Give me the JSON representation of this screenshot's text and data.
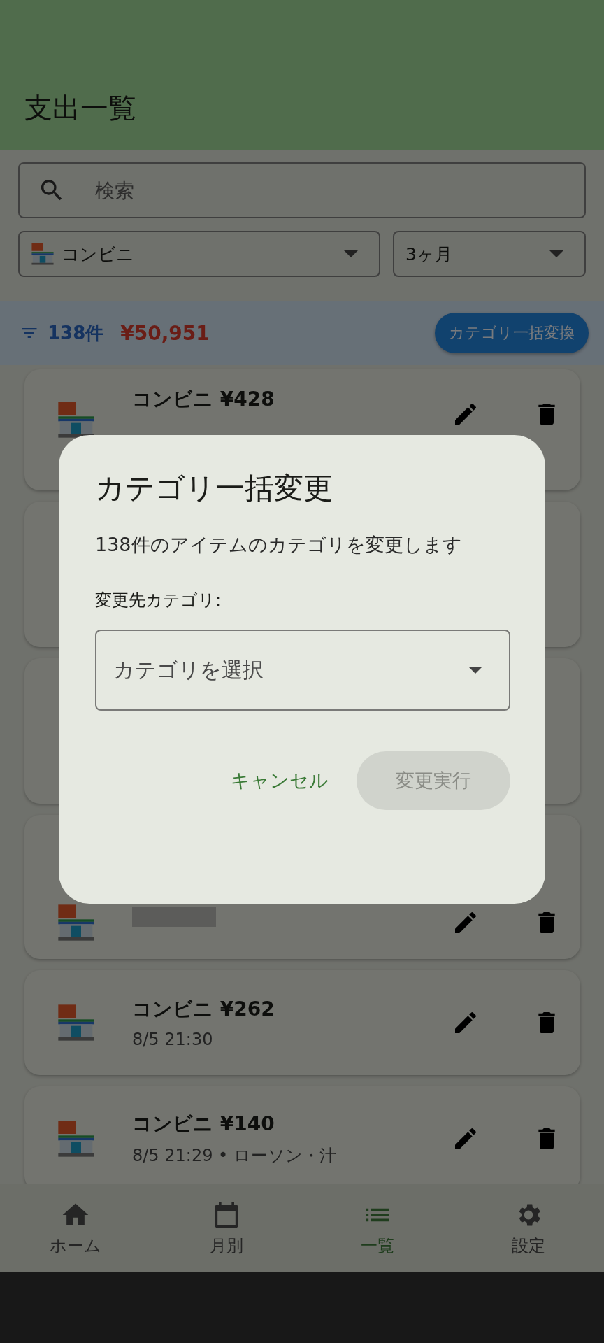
{
  "app_bar": {
    "title": "支出一覧"
  },
  "search": {
    "placeholder": "検索"
  },
  "filters": [
    {
      "kind": "category",
      "value": "コンビニ"
    },
    {
      "kind": "period",
      "value": "3ヶ月"
    }
  ],
  "summary": {
    "count": "138件",
    "total": "¥50,951",
    "button": "カテゴリ一括変換"
  },
  "expenses": [
    {
      "kind": "partial",
      "title": "コンビニ ¥428"
    },
    {
      "kind": "covered"
    },
    {
      "kind": "covered"
    },
    {
      "kind": "redacted"
    },
    {
      "kind": "text",
      "title": "コンビニ ¥262",
      "detail": "8/5 21:30"
    },
    {
      "kind": "text",
      "title": "コンビニ ¥140",
      "detail": "8/5 21:29 • ローソン・汁"
    }
  ],
  "dialog": {
    "title": "カテゴリ一括変更",
    "message": "138件のアイテムのカテゴリを変更します",
    "field_label": "変更先カテゴリ:",
    "select_placeholder": "カテゴリを選択",
    "cancel": "キャンセル",
    "confirm": {
      "label": "変更実行",
      "disabled": true
    }
  },
  "nav": [
    {
      "kind": "home",
      "label": "ホーム",
      "selected": false
    },
    {
      "kind": "calendar",
      "label": "月別",
      "selected": false
    },
    {
      "kind": "list",
      "label": "一覧",
      "selected": true
    },
    {
      "kind": "settings",
      "label": "設定",
      "selected": false
    }
  ]
}
